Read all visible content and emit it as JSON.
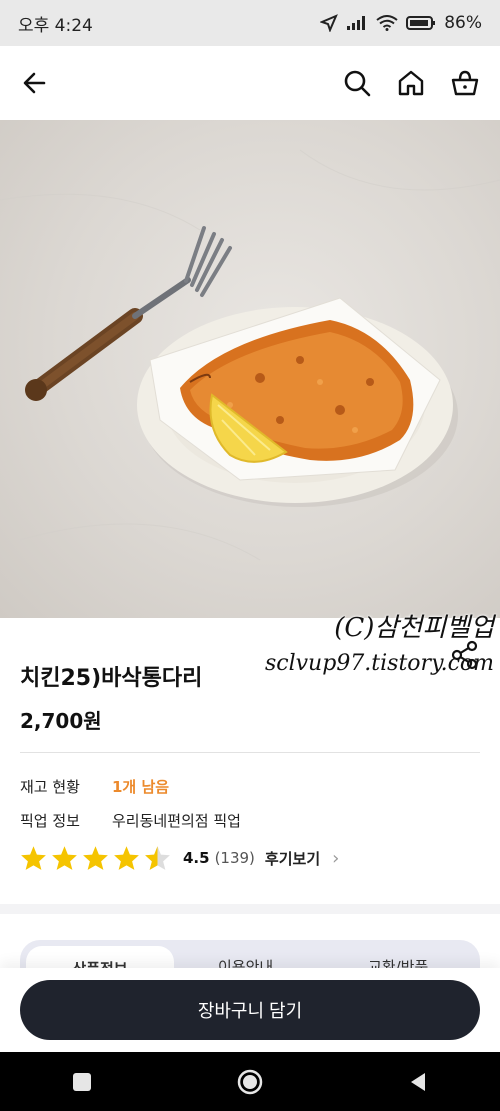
{
  "status_bar": {
    "time": "오후 4:24",
    "battery": "86%"
  },
  "top_nav": {
    "icons": [
      "back-arrow-icon",
      "search-icon",
      "home-icon",
      "basket-icon"
    ]
  },
  "product": {
    "name": "치킨25)바삭통다리",
    "price": "2,700원",
    "stock_label": "재고 현황",
    "stock_value": "1개 남음",
    "pickup_label": "픽업 정보",
    "pickup_value": "우리동네편의점 픽업",
    "rating_score": "4.5",
    "rating_count": "(139)",
    "review_link": "후기보기",
    "rating": 4.5
  },
  "watermark": {
    "line1": "(C)삼천피벨업",
    "line2": "sclvup97.tistory.com"
  },
  "tabs": [
    "상품정보",
    "이용안내",
    "교환/반품"
  ],
  "cart_button": "장바구니 담기",
  "colors": {
    "accent": "#ec8a2c",
    "button": "#1f232d",
    "star": "#f5c400"
  }
}
